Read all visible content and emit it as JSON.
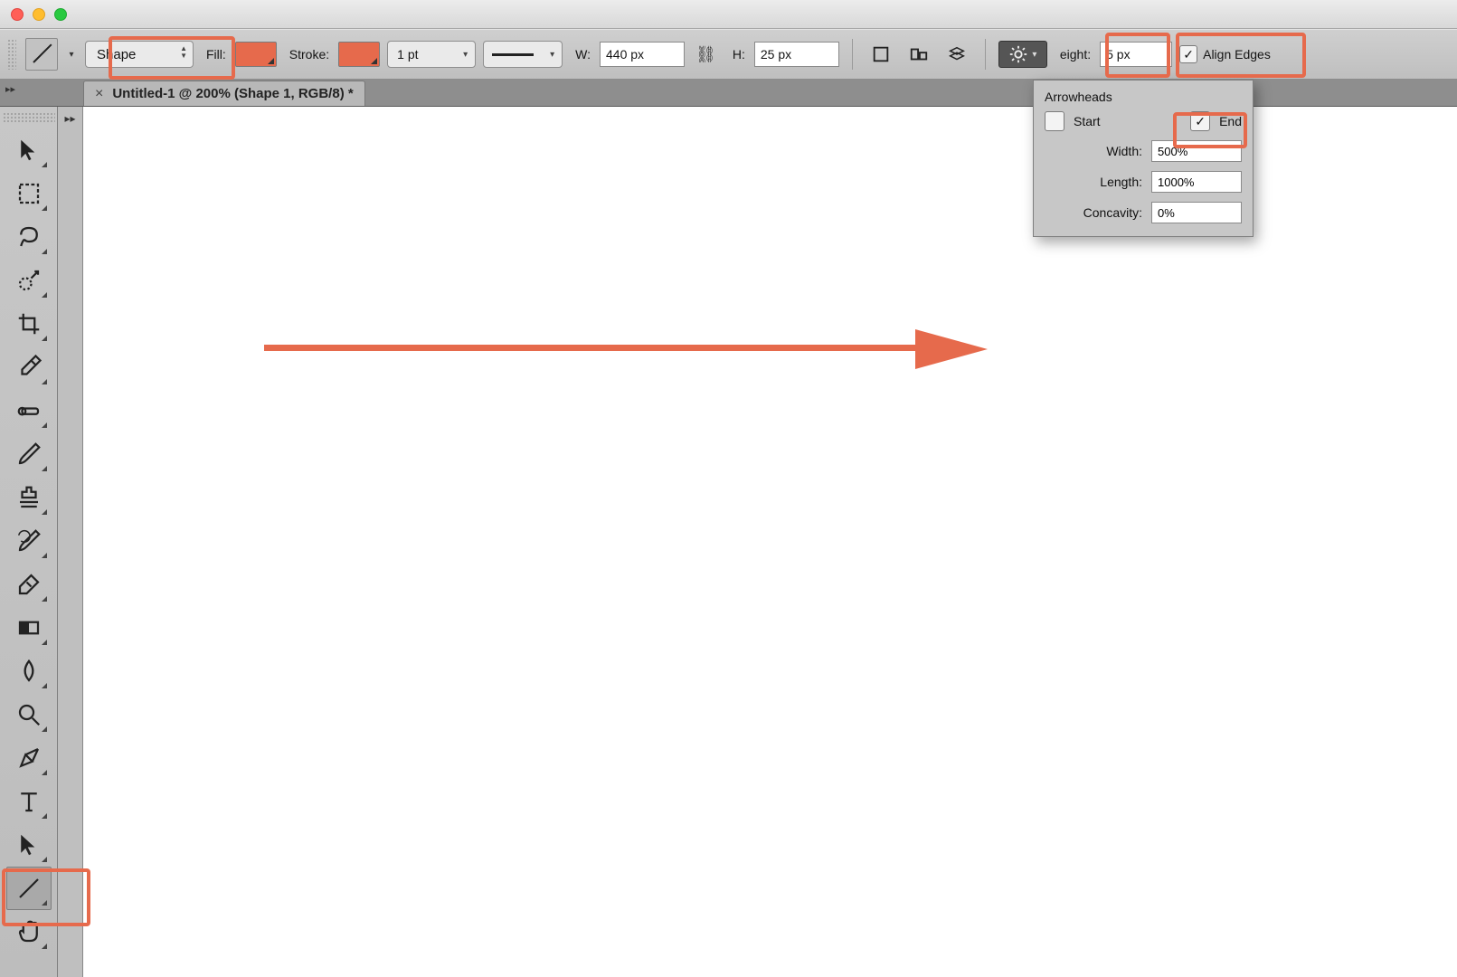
{
  "titlebar": {
    "title": ""
  },
  "optionsBar": {
    "mode": "Shape",
    "fillLabel": "Fill:",
    "fillColor": "#e66a4c",
    "strokeLabel": "Stroke:",
    "strokeColor": "#e66a4c",
    "strokeWeight": "1 pt",
    "wLabel": "W:",
    "width": "440 px",
    "hLabel": "H:",
    "height": "25 px",
    "weightLabel": "eight:",
    "weightValue": "5 px",
    "alignEdges": "Align Edges",
    "alignEdgesChecked": true
  },
  "docTab": {
    "title": "Untitled-1 @ 200% (Shape 1, RGB/8) *"
  },
  "tools": [
    {
      "name": "move-tool"
    },
    {
      "name": "marquee-tool"
    },
    {
      "name": "lasso-tool"
    },
    {
      "name": "quick-selection-tool"
    },
    {
      "name": "crop-tool"
    },
    {
      "name": "eyedropper-tool"
    },
    {
      "name": "healing-brush-tool"
    },
    {
      "name": "brush-tool"
    },
    {
      "name": "clone-stamp-tool"
    },
    {
      "name": "history-brush-tool"
    },
    {
      "name": "eraser-tool"
    },
    {
      "name": "gradient-tool"
    },
    {
      "name": "blur-tool"
    },
    {
      "name": "zoom-tool"
    },
    {
      "name": "pen-tool"
    },
    {
      "name": "type-tool"
    },
    {
      "name": "path-selection-tool"
    },
    {
      "name": "line-tool",
      "selected": true
    },
    {
      "name": "hand-tool"
    }
  ],
  "popover": {
    "title": "Arrowheads",
    "startLabel": "Start",
    "startChecked": false,
    "endLabel": "End",
    "endChecked": true,
    "widthLabel": "Width:",
    "widthValue": "500%",
    "lengthLabel": "Length:",
    "lengthValue": "1000%",
    "concavityLabel": "Concavity:",
    "concavityValue": "0%"
  },
  "arrow": {
    "color": "#e66a4c"
  }
}
